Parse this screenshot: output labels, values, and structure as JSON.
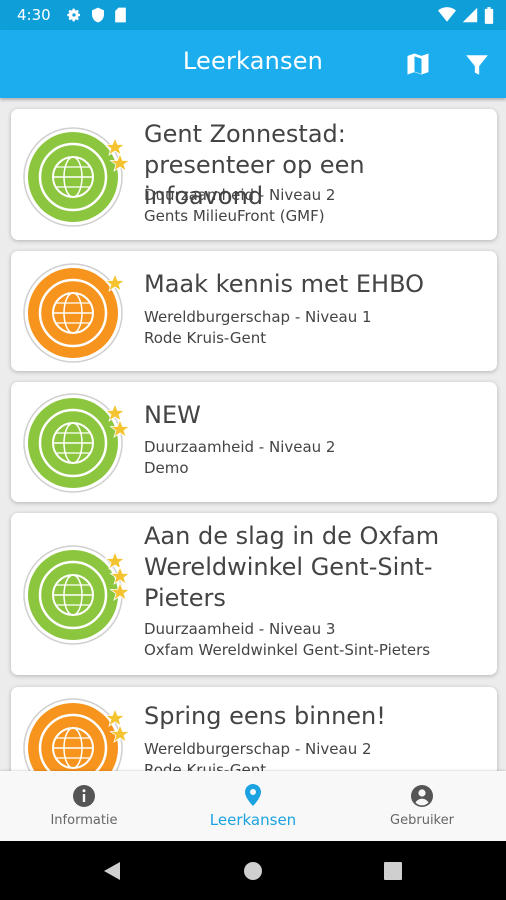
{
  "status_bar": {
    "time": "4:30",
    "icons_left": [
      "gear-icon",
      "shield-icon",
      "sd-card-icon"
    ],
    "icons_right": [
      "wifi-icon",
      "signal-icon",
      "battery-icon"
    ]
  },
  "header": {
    "title": "Leerkansen",
    "actions": [
      "map-icon",
      "filter-icon"
    ]
  },
  "colors": {
    "primary": "#1badee",
    "status_bar": "#0f9fd8",
    "active_tab": "#1aa3e0",
    "badge_green": "#8cc63f",
    "badge_orange": "#f7941d",
    "star": "#f4c430"
  },
  "cards": [
    {
      "title": "Gent Zonnestad:  presenteer op een infoavond",
      "category": "Duurzaamheid - Niveau 2",
      "organization": "Gents MilieuFront (GMF)",
      "badge": "green",
      "stars": 2
    },
    {
      "title": "Maak kennis met EHBO",
      "category": "Wereldburgerschap - Niveau 1",
      "organization": "Rode Kruis-Gent",
      "badge": "orange",
      "stars": 1
    },
    {
      "title": "NEW",
      "category": "Duurzaamheid - Niveau 2",
      "organization": "Demo",
      "badge": "green",
      "stars": 2
    },
    {
      "title": "Aan de slag in de Oxfam Wereldwinkel Gent-Sint-Pieters",
      "category": "Duurzaamheid - Niveau 3",
      "organization": "Oxfam Wereldwinkel Gent-Sint-Pieters",
      "badge": "green",
      "stars": 3
    },
    {
      "title": "Spring eens binnen!",
      "category": "Wereldburgerschap - Niveau 2",
      "organization": "Rode Kruis-Gent",
      "badge": "orange",
      "stars": 2
    }
  ],
  "bottom_nav": {
    "items": [
      {
        "label": "Informatie",
        "icon": "info-icon"
      },
      {
        "label": "Leerkansen",
        "icon": "location-pin-icon",
        "active": true
      },
      {
        "label": "Gebruiker",
        "icon": "account-circle-icon"
      }
    ]
  }
}
